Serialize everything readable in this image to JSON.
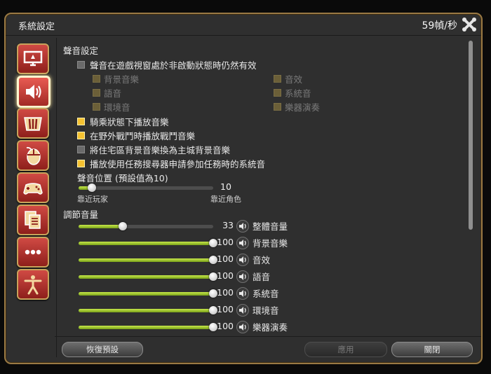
{
  "window": {
    "title": "系統設定",
    "fps": "59幀/秒"
  },
  "sidebar": {
    "items": [
      {
        "icon": "display-icon"
      },
      {
        "icon": "speaker-icon",
        "active": true
      },
      {
        "icon": "palette-icon"
      },
      {
        "icon": "mouse-icon"
      },
      {
        "icon": "gamepad-icon"
      },
      {
        "icon": "document-icon"
      },
      {
        "icon": "ellipsis-icon"
      },
      {
        "icon": "figure-icon"
      }
    ]
  },
  "sound": {
    "section_title": "聲音設定",
    "inactive_window": {
      "label": "聲音在遊戲視窗處於非啟動狀態時仍然有效",
      "checked": false
    },
    "sub": {
      "bgm": "背景音樂",
      "se": "音效",
      "voice": "語音",
      "system": "系統音",
      "ambient": "環境音",
      "instrument": "樂器演奏"
    },
    "mount_bgm": {
      "label": "騎乘狀態下播放音樂",
      "checked": true
    },
    "battle_bgm": {
      "label": "在野外戰鬥時播放戰鬥音樂",
      "checked": true
    },
    "housing_bgm": {
      "label": "將住宅區背景音樂換為主城背景音樂",
      "checked": false
    },
    "duty_finder_sound": {
      "label": "播放使用任務搜尋器申請參加任務時的系統音",
      "checked": true
    },
    "position": {
      "label": "聲音位置 (預設值為10)",
      "value": "10",
      "left_label": "靠近玩家",
      "right_label": "靠近角色",
      "fraction": 0.1
    }
  },
  "volume": {
    "section_title": "調節音量",
    "rows": [
      {
        "label": "整體音量",
        "value": "33",
        "fraction": 0.33
      },
      {
        "label": "背景音樂",
        "value": "100",
        "fraction": 1.0
      },
      {
        "label": "音效",
        "value": "100",
        "fraction": 1.0
      },
      {
        "label": "語音",
        "value": "100",
        "fraction": 1.0
      },
      {
        "label": "系統音",
        "value": "100",
        "fraction": 1.0
      },
      {
        "label": "環境音",
        "value": "100",
        "fraction": 1.0
      },
      {
        "label": "樂器演奏",
        "value": "100",
        "fraction": 1.0
      }
    ]
  },
  "footer": {
    "reset": "恢復預設",
    "apply": "應用",
    "close": "關閉"
  },
  "colors": {
    "accent_check": "#f5c231",
    "slider_fill": "#9cc22a",
    "frame": "#9a7a45"
  }
}
